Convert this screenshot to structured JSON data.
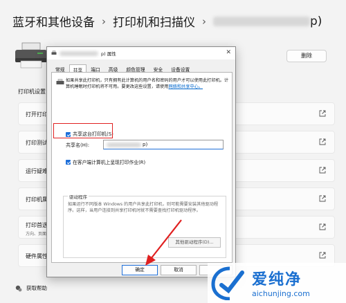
{
  "breadcrumb": {
    "item1": "蓝牙和其他设备",
    "sep": "›",
    "item2": "打印机和扫描仪",
    "item3_suffix": "p)"
  },
  "remove_button": "删除",
  "section_label": "打印机设置",
  "rows": [
    {
      "label": "打开打印"
    },
    {
      "label": "打印测试"
    },
    {
      "label": "运行疑难"
    },
    {
      "label": "打印机属"
    },
    {
      "label": "打印首选",
      "sub": "方向、页面"
    },
    {
      "label": "硬件属性"
    }
  ],
  "help": "获取帮助",
  "dialog": {
    "title_suffix": "p) 属性",
    "tabs": [
      "常规",
      "共享",
      "端口",
      "高级",
      "颜色管理",
      "安全",
      "设备设置"
    ],
    "desc_text": "如果共享此打印机，只有拥有此计算机的用户名和密码的用户才可以使用此打印机。计算机睡眠时打印机将不可用。要更改这些设置，请使用",
    "desc_link": "网络和共享中心。",
    "share_checkbox": "共享这台打印机(S)",
    "share_name_label": "共享名(H):",
    "share_name_value": "p)",
    "render_checkbox": "在客户端计算机上呈现打印作业(R)",
    "driver_group_title": "驱动程序",
    "driver_text": "如果运行不同版本 Windows 的用户共享此打印机，则可能需要安装其他驱动程序。这样，当用户连接到共享打印机时就不需要查找打印机驱动程序。",
    "driver_button": "其他驱动程序(D)...",
    "ok": "确定",
    "cancel": "取消"
  },
  "watermark": {
    "cn": "爱纯净",
    "en": "aichunjing.com"
  },
  "colors": {
    "accent": "#1e6fd9",
    "highlight": "#e02020",
    "watermark": "#1a6fd0"
  }
}
